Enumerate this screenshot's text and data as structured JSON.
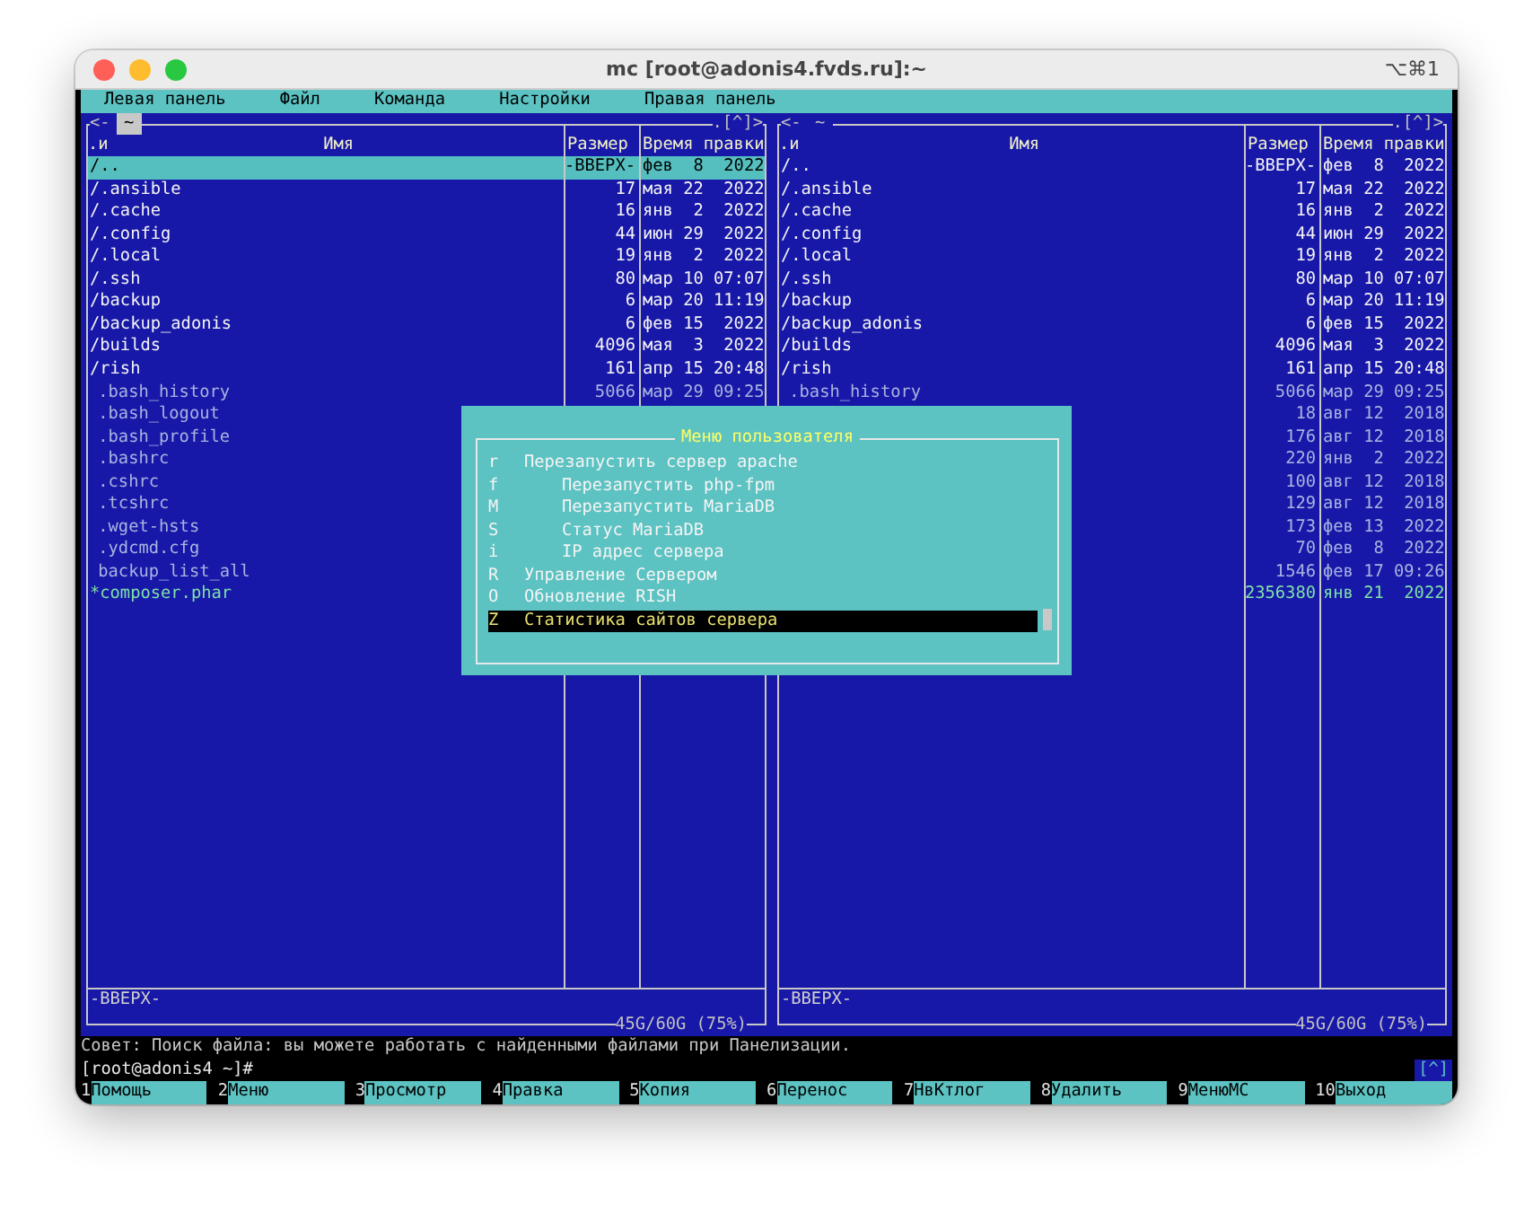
{
  "window": {
    "title": "mc [root@adonis4.fvds.ru]:~",
    "shortcut": "⌥⌘1"
  },
  "menu_bar": [
    "Левая панель",
    "Файл",
    "Команда",
    "Настройки",
    "Правая панель"
  ],
  "panels": [
    {
      "active": true,
      "nav_left": "<-",
      "path": "~",
      "nav_right": ".[^]>",
      "columns": [
        ".и",
        "Имя",
        "Размер",
        "Время правки"
      ],
      "rows": [
        {
          "name": "/..",
          "size": "-ВВЕРХ-",
          "time": "фев  8  2022",
          "kind": "dir",
          "selected": true
        },
        {
          "name": "/.ansible",
          "size": "17",
          "time": "мая 22  2022",
          "kind": "dir",
          "selected": false
        },
        {
          "name": "/.cache",
          "size": "16",
          "time": "янв  2  2022",
          "kind": "dir",
          "selected": false
        },
        {
          "name": "/.config",
          "size": "44",
          "time": "июн 29  2022",
          "kind": "dir",
          "selected": false
        },
        {
          "name": "/.local",
          "size": "19",
          "time": "янв  2  2022",
          "kind": "dir",
          "selected": false
        },
        {
          "name": "/.ssh",
          "size": "80",
          "time": "мар 10 07:07",
          "kind": "dir",
          "selected": false
        },
        {
          "name": "/backup",
          "size": "6",
          "time": "мар 20 11:19",
          "kind": "dir",
          "selected": false
        },
        {
          "name": "/backup_adonis",
          "size": "6",
          "time": "фев 15  2022",
          "kind": "dir",
          "selected": false
        },
        {
          "name": "/builds",
          "size": "4096",
          "time": "мая  3  2022",
          "kind": "dir",
          "selected": false
        },
        {
          "name": "/rish",
          "size": "161",
          "time": "апр 15 20:48",
          "kind": "dir",
          "selected": false
        },
        {
          "name": ".bash_history",
          "size": "5066",
          "time": "мар 29 09:25",
          "kind": "file",
          "selected": false
        },
        {
          "name": ".bash_logout",
          "kind": "file",
          "selected": false
        },
        {
          "name": ".bash_profile",
          "kind": "file",
          "selected": false
        },
        {
          "name": ".bashrc",
          "kind": "file",
          "selected": false
        },
        {
          "name": ".cshrc",
          "kind": "file",
          "selected": false
        },
        {
          "name": ".tcshrc",
          "kind": "file",
          "selected": false
        },
        {
          "name": ".wget-hsts",
          "kind": "file",
          "selected": false
        },
        {
          "name": ".ydcmd.cfg",
          "kind": "file",
          "selected": false
        },
        {
          "name": "backup_list_all",
          "kind": "file",
          "selected": false
        },
        {
          "name": "*composer.phar",
          "kind": "exec",
          "selected": false
        }
      ],
      "mini_status": "-ВВЕРХ-",
      "disk": "45G/60G (75%)"
    },
    {
      "active": false,
      "nav_left": "<-",
      "path": "~",
      "nav_right": ".[^]>",
      "columns": [
        ".и",
        "Имя",
        "Размер",
        "Время правки"
      ],
      "rows": [
        {
          "name": "/..",
          "size": "-ВВЕРХ-",
          "time": "фев  8  2022",
          "kind": "dir",
          "selected": false
        },
        {
          "name": "/.ansible",
          "size": "17",
          "time": "мая 22  2022",
          "kind": "dir",
          "selected": false
        },
        {
          "name": "/.cache",
          "size": "16",
          "time": "янв  2  2022",
          "kind": "dir",
          "selected": false
        },
        {
          "name": "/.config",
          "size": "44",
          "time": "июн 29  2022",
          "kind": "dir",
          "selected": false
        },
        {
          "name": "/.local",
          "size": "19",
          "time": "янв  2  2022",
          "kind": "dir",
          "selected": false
        },
        {
          "name": "/.ssh",
          "size": "80",
          "time": "мар 10 07:07",
          "kind": "dir",
          "selected": false
        },
        {
          "name": "/backup",
          "size": "6",
          "time": "мар 20 11:19",
          "kind": "dir",
          "selected": false
        },
        {
          "name": "/backup_adonis",
          "size": "6",
          "time": "фев 15  2022",
          "kind": "dir",
          "selected": false
        },
        {
          "name": "/builds",
          "size": "4096",
          "time": "мая  3  2022",
          "kind": "dir",
          "selected": false
        },
        {
          "name": "/rish",
          "size": "161",
          "time": "апр 15 20:48",
          "kind": "dir",
          "selected": false
        },
        {
          "name": ".bash_history",
          "size": "5066",
          "time": "мар 29 09:25",
          "kind": "file",
          "selected": false
        },
        {
          "size": "18",
          "time": "авг 12  2018",
          "kind": "file",
          "selected": false
        },
        {
          "size": "176",
          "time": "авг 12  2018",
          "kind": "file",
          "selected": false
        },
        {
          "size": "220",
          "time": "янв  2  2022",
          "kind": "file",
          "selected": false
        },
        {
          "size": "100",
          "time": "авг 12  2018",
          "kind": "file",
          "selected": false
        },
        {
          "size": "129",
          "time": "авг 12  2018",
          "kind": "file",
          "selected": false
        },
        {
          "size": "173",
          "time": "фев 13  2022",
          "kind": "file",
          "selected": false
        },
        {
          "size": "70",
          "time": "фев  8  2022",
          "kind": "file",
          "selected": false
        },
        {
          "size": "1546",
          "time": "фев 17 09:26",
          "kind": "file",
          "selected": false
        },
        {
          "size": "2356380",
          "time": "янв 21  2022",
          "kind": "exec",
          "selected": false
        }
      ],
      "mini_status": "-ВВЕРХ-",
      "disk": "45G/60G (75%)"
    }
  ],
  "dialog": {
    "title": "Меню пользователя",
    "items": [
      {
        "key": "r",
        "label": "Перезапустить сервер apache",
        "indented": false,
        "selected": false
      },
      {
        "key": "f",
        "label": "Перезапустить php-fpm",
        "indented": true,
        "selected": false
      },
      {
        "key": "M",
        "label": "Перезапустить MariaDB",
        "indented": true,
        "selected": false
      },
      {
        "key": "S",
        "label": "Статус MariaDB",
        "indented": true,
        "selected": false
      },
      {
        "key": "i",
        "label": "IP адрес сервера",
        "indented": true,
        "selected": false
      },
      {
        "key": "R",
        "label": "Управление Сервером",
        "indented": false,
        "selected": false
      },
      {
        "key": "O",
        "label": "Обновление RISH",
        "indented": false,
        "selected": false
      },
      {
        "key": "Z",
        "label": "Статистика сайтов сервера",
        "indented": false,
        "selected": true
      }
    ]
  },
  "hint": "Совет: Поиск файла: вы можете работать с найденными файлами при Панелизации.",
  "prompt": "[root@adonis4 ~]#",
  "history_button": "[^]",
  "function_keys": [
    {
      "num": "1",
      "label": "Помощь"
    },
    {
      "num": "2",
      "label": "Меню"
    },
    {
      "num": "3",
      "label": "Просмотр"
    },
    {
      "num": "4",
      "label": "Правка"
    },
    {
      "num": "5",
      "label": "Копия"
    },
    {
      "num": "6",
      "label": "Перенос"
    },
    {
      "num": "7",
      "label": "НвКтлог"
    },
    {
      "num": "8",
      "label": "Удалить"
    },
    {
      "num": "9",
      "label": "МенюМС"
    },
    {
      "num": "10",
      "label": "Выход"
    }
  ]
}
